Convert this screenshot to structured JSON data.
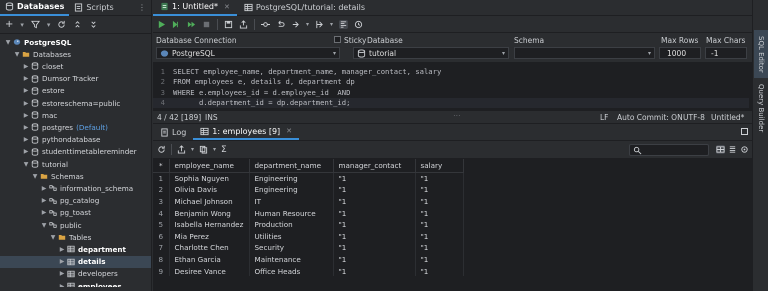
{
  "left_panel": {
    "tabs": [
      {
        "label": "Databases",
        "icon": "database-icon"
      },
      {
        "label": "Scripts",
        "icon": "scripts-icon"
      }
    ],
    "tree": [
      {
        "label": "PostgreSQL",
        "icon": "postgres-icon",
        "bold": true,
        "expanded": true,
        "indent": 0
      },
      {
        "label": "Databases",
        "icon": "folder-icon",
        "bold": false,
        "expanded": true,
        "indent": 1
      },
      {
        "label": "closet",
        "icon": "database-icon",
        "expanded": false,
        "indent": 2
      },
      {
        "label": "Dumsor Tracker",
        "icon": "database-icon",
        "expanded": false,
        "indent": 2
      },
      {
        "label": "estore",
        "icon": "database-icon",
        "expanded": false,
        "indent": 2
      },
      {
        "label": "estoreschema=public",
        "icon": "database-icon",
        "expanded": false,
        "indent": 2
      },
      {
        "label": "mac",
        "icon": "database-icon",
        "expanded": false,
        "indent": 2
      },
      {
        "label": "postgres",
        "extra": "(Default)",
        "icon": "database-icon",
        "expanded": false,
        "indent": 2
      },
      {
        "label": "pythondatabase",
        "icon": "database-icon",
        "expanded": false,
        "indent": 2
      },
      {
        "label": "studenttimetablereminder",
        "icon": "database-icon",
        "expanded": false,
        "indent": 2
      },
      {
        "label": "tutorial",
        "icon": "database-icon",
        "expanded": true,
        "indent": 2
      },
      {
        "label": "Schemas",
        "icon": "folder-icon",
        "expanded": true,
        "indent": 3
      },
      {
        "label": "information_schema",
        "icon": "schema-icon",
        "expanded": false,
        "indent": 4
      },
      {
        "label": "pg_catalog",
        "icon": "schema-icon",
        "expanded": false,
        "indent": 4
      },
      {
        "label": "pg_toast",
        "icon": "schema-icon",
        "expanded": false,
        "indent": 4
      },
      {
        "label": "public",
        "icon": "schema-icon",
        "expanded": true,
        "indent": 4
      },
      {
        "label": "Tables",
        "icon": "folder-icon",
        "expanded": true,
        "indent": 5
      },
      {
        "label": "department",
        "icon": "table-icon",
        "bold": true,
        "expanded": false,
        "indent": 6
      },
      {
        "label": "details",
        "icon": "table-icon",
        "bold": true,
        "expanded": false,
        "indent": 6,
        "selected": true
      },
      {
        "label": "developers",
        "icon": "table-icon",
        "expanded": false,
        "indent": 6
      },
      {
        "label": "employees",
        "icon": "table-icon",
        "bold": true,
        "expanded": false,
        "indent": 6
      }
    ]
  },
  "editor_tabs": [
    {
      "label": "1: Untitled*",
      "active": true
    },
    {
      "label": "PostgreSQL/tutorial: details",
      "active": false
    }
  ],
  "connection_bar": {
    "db_connection_label": "Database Connection",
    "db_connection_value": "PostgreSQL",
    "sticky_label": "Sticky",
    "database_label": "Database",
    "database_value": "tutorial",
    "schema_label": "Schema",
    "schema_value": "",
    "max_rows_label": "Max Rows",
    "max_rows_value": "1000",
    "max_chars_label": "Max Chars",
    "max_chars_value": "-1"
  },
  "editor": {
    "lines": [
      {
        "num": "1",
        "text": "SELECT employee_name, department_name, manager_contact, salary"
      },
      {
        "num": "2",
        "text": "FROM employees e, details d, department dp"
      },
      {
        "num": "3",
        "text": "WHERE e.employees_id = d.employee_id  AND"
      },
      {
        "num": "4",
        "text": "      d.department_id = dp.department_id;"
      }
    ]
  },
  "editor_status": {
    "position": "4 / 42 [189]",
    "mode": "INS",
    "line_ending": "LF",
    "autocommit": "Auto Commit: ON",
    "encoding": "UTF-8",
    "file": "Untitled*"
  },
  "result_tabs": [
    {
      "label": "Log",
      "active": false
    },
    {
      "label": "1: employees [9]",
      "active": true
    }
  ],
  "results": {
    "columns": [
      "*",
      "employee_name",
      "department_name",
      "manager_contact",
      "salary"
    ],
    "rows": [
      [
        "1",
        "Sophia Nguyen",
        "Engineering",
        "\"1",
        "\"1"
      ],
      [
        "2",
        "Olivia Davis",
        "Engineering",
        "\"1",
        "\"1"
      ],
      [
        "3",
        "Michael Johnson",
        "IT",
        "\"1",
        "\"1"
      ],
      [
        "4",
        "Benjamin Wong",
        "Human Resource",
        "\"1",
        "\"1"
      ],
      [
        "5",
        "Isabella Hernandez",
        "Production",
        "\"1",
        "\"1"
      ],
      [
        "6",
        "Mia Perez",
        "Utilities",
        "\"1",
        "\"1"
      ],
      [
        "7",
        "Charlotte Chen",
        "Security",
        "\"1",
        "\"1"
      ],
      [
        "8",
        "Ethan Garcia",
        "Maintenance",
        "\"1",
        "\"1"
      ],
      [
        "9",
        "Desiree Vance",
        "Office Heads",
        "\"1",
        "\"1"
      ]
    ]
  },
  "right_panel": {
    "tabs": [
      "SQL Editor",
      "Query Builder"
    ]
  },
  "colors": {
    "accent": "#3a8fd8",
    "run_green": "#4fae5a",
    "folder_yellow": "#d9a343",
    "panel_bg": "#2b2d30",
    "editor_bg": "#1e1f22"
  }
}
